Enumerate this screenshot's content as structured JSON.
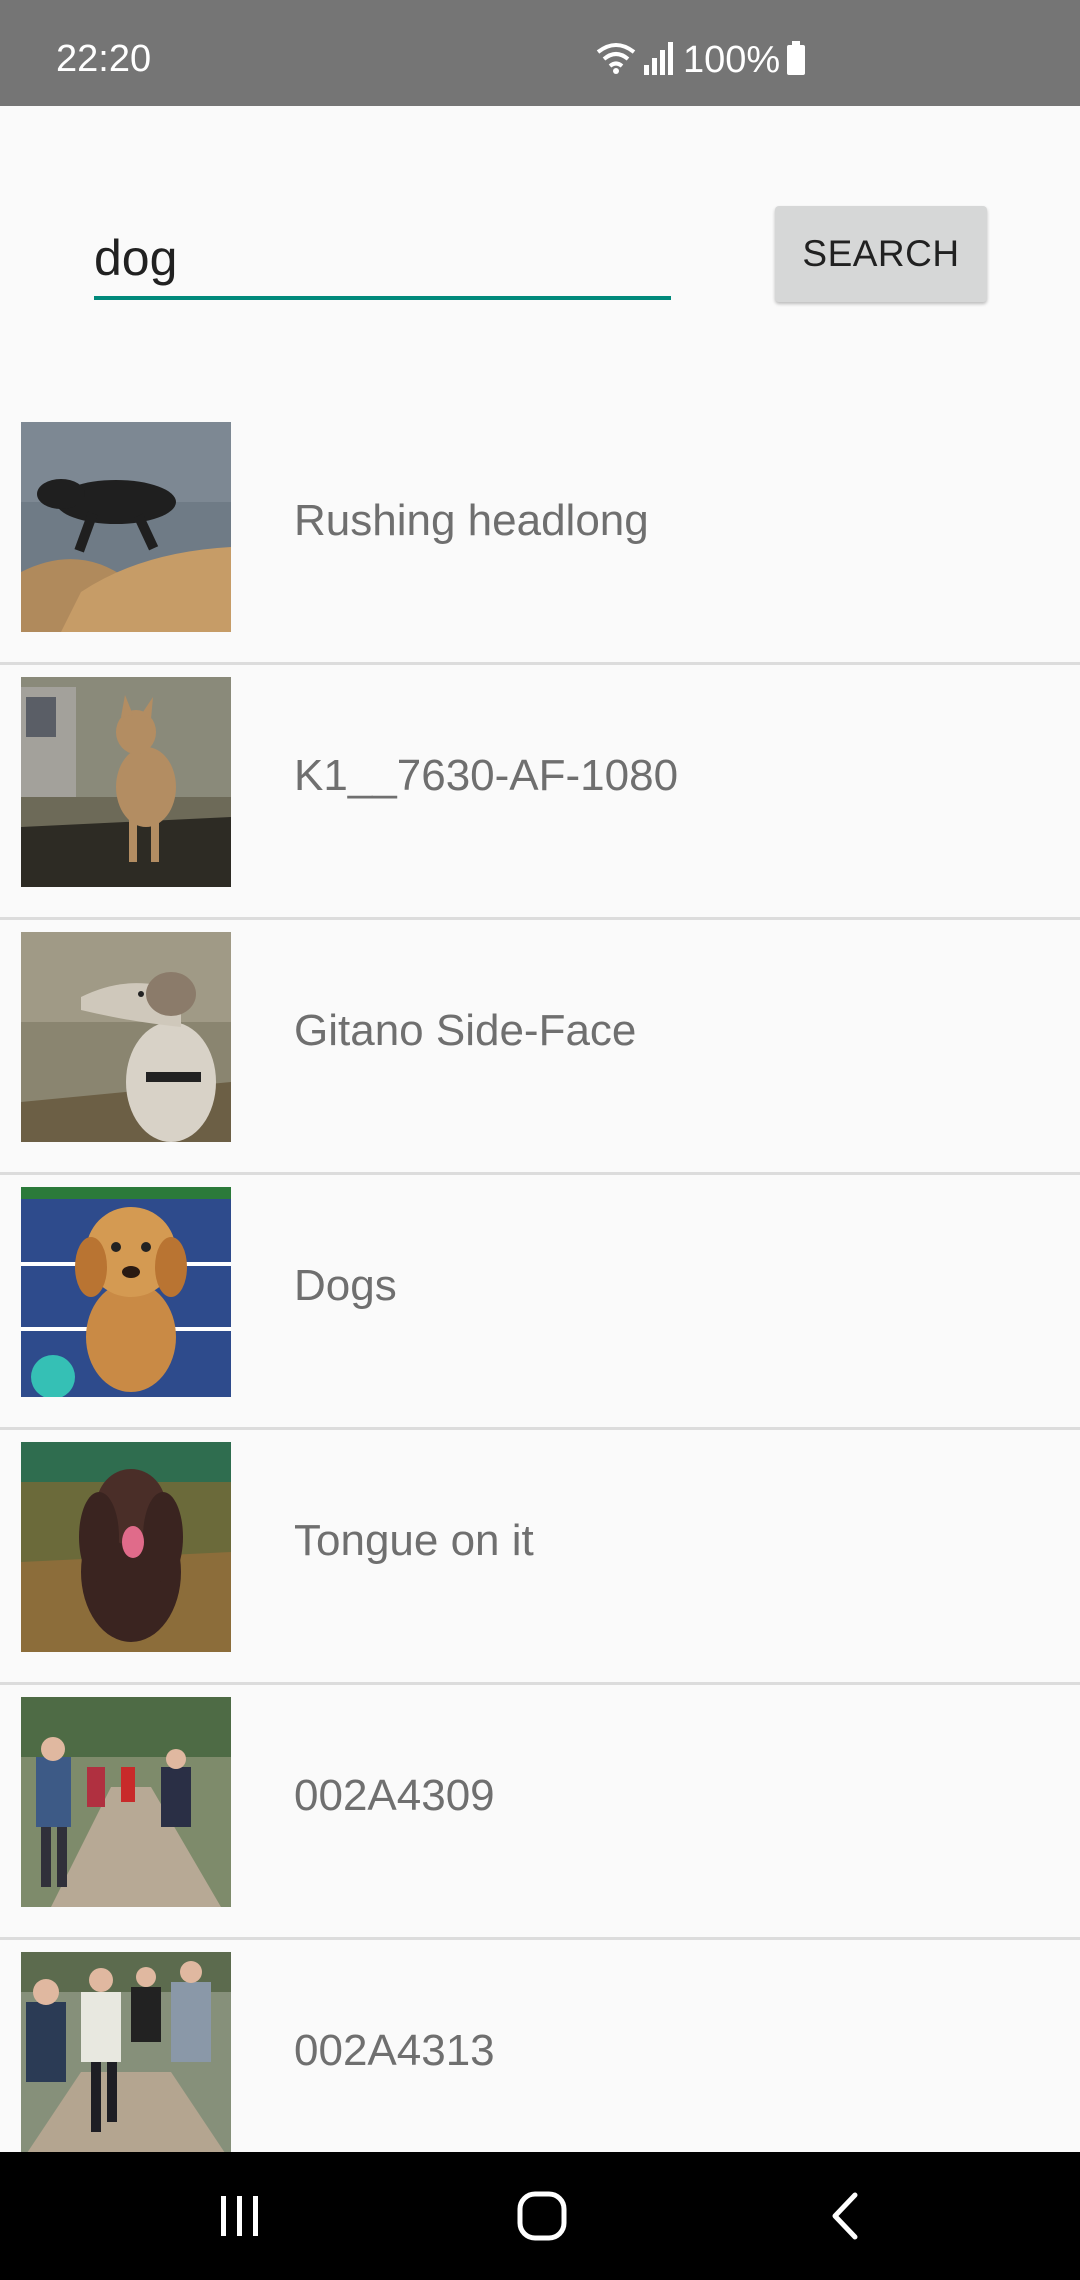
{
  "status_bar": {
    "time": "22:20",
    "battery_percent": "100%",
    "icons": [
      "wifi-icon",
      "signal-icon",
      "battery-icon"
    ]
  },
  "search": {
    "query": "dog",
    "button_label": "SEARCH",
    "underline_color": "#00897b"
  },
  "results": [
    {
      "title": "Rushing headlong",
      "thumb": "black dog running on rocky shore"
    },
    {
      "title": "K1__7630-AF-1080",
      "thumb": "tan small dog in yard"
    },
    {
      "title": "Gitano Side-Face",
      "thumb": "greyhound side profile"
    },
    {
      "title": "Dogs",
      "thumb": "golden puppy on tennis court"
    },
    {
      "title": "Tongue on it",
      "thumb": "brown spaniel with tongue out"
    },
    {
      "title": "002A4309",
      "thumb": "runners on trail"
    },
    {
      "title": "002A4313",
      "thumb": "group of runners"
    }
  ],
  "nav_bar": {
    "icons": [
      "recents-icon",
      "home-icon",
      "back-icon"
    ]
  },
  "colors": {
    "status_bar": "#757575",
    "background": "#fafafa",
    "accent": "#00897b",
    "nav_bar": "#000000"
  }
}
